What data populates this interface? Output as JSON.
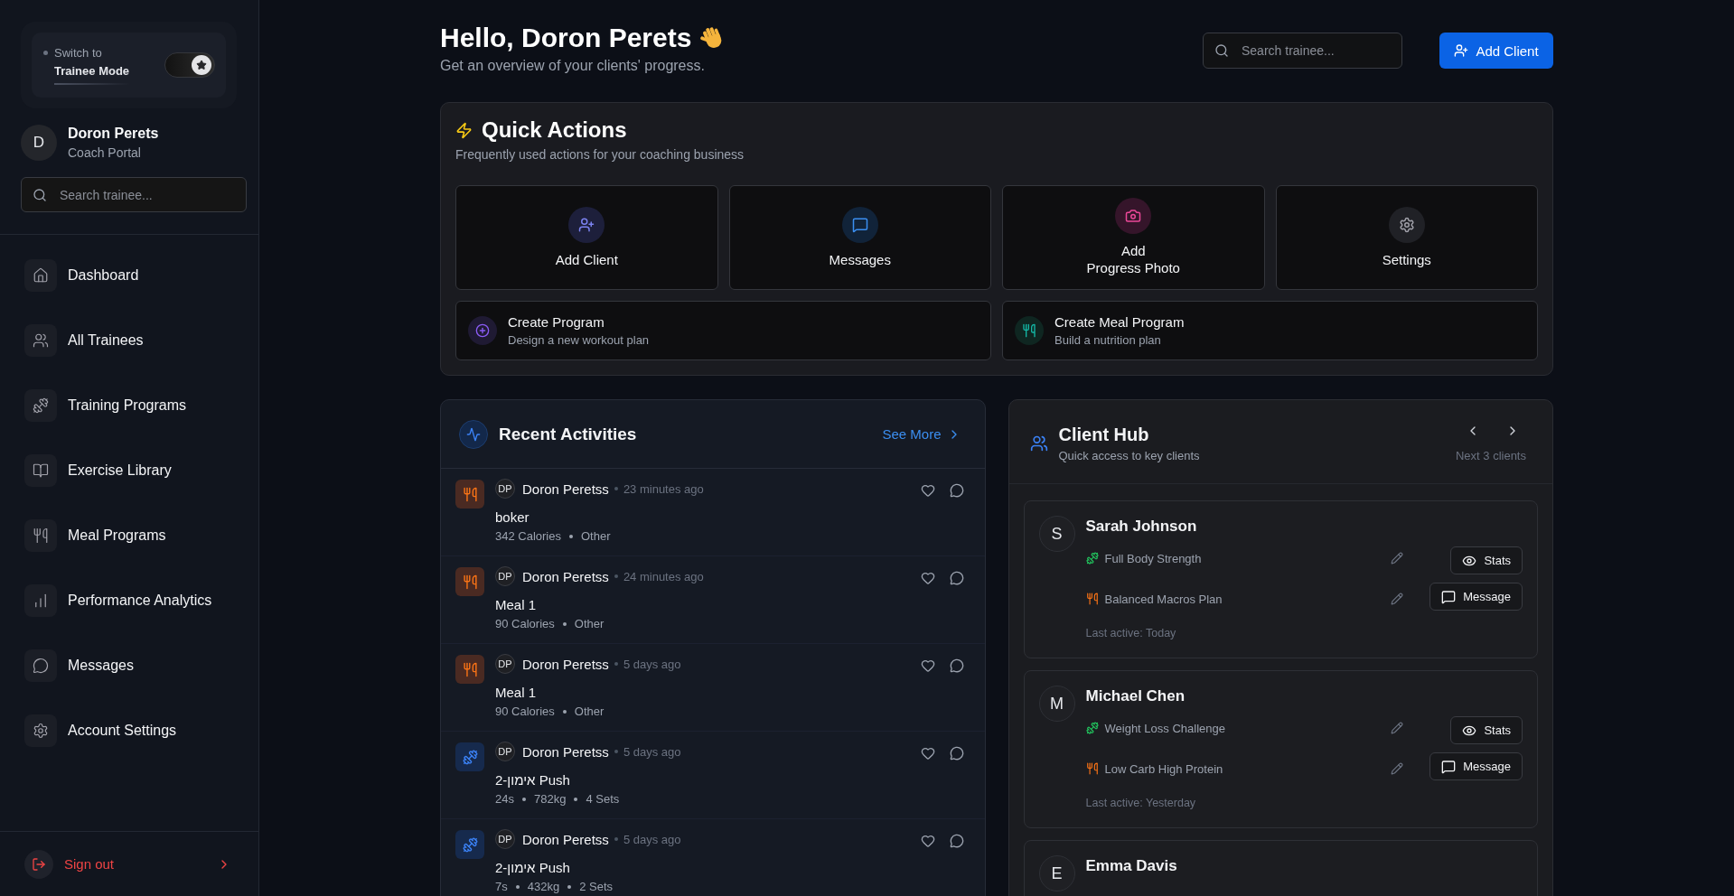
{
  "sidebar": {
    "mode_switch": {
      "prefix": "Switch to",
      "mode": "Trainee Mode",
      "on": true
    },
    "profile": {
      "initial": "D",
      "name": "Doron Perets",
      "role": "Coach Portal"
    },
    "search": {
      "placeholder": "Search trainee..."
    },
    "nav": [
      {
        "label": "Dashboard",
        "kind": "home",
        "selected": false
      },
      {
        "label": "All Trainees",
        "kind": "users",
        "selected": false
      },
      {
        "label": "Training Programs",
        "kind": "workout",
        "selected": false
      },
      {
        "label": "Exercise Library",
        "kind": "book",
        "selected": false
      },
      {
        "label": "Meal Programs",
        "kind": "meal",
        "selected": false
      },
      {
        "label": "Performance Analytics",
        "kind": "chart",
        "selected": false
      },
      {
        "label": "Messages",
        "kind": "message",
        "selected": false
      },
      {
        "label": "Account Settings",
        "kind": "settings",
        "selected": false
      }
    ],
    "sign_out": {
      "label": "Sign out"
    }
  },
  "header": {
    "title": "Hello, Doron Perets",
    "subtitle": "Get an overview of your clients' progress.",
    "search": {
      "placeholder": "Search trainee..."
    },
    "primary_button": "Add Client"
  },
  "quick_actions": {
    "title": "Quick Actions",
    "subtitle": "Frequently used actions for your coaching business",
    "tiles": [
      {
        "label": "Add Client",
        "kind": "client"
      },
      {
        "label": "Messages",
        "kind": "messages"
      },
      {
        "label": "Add\nProgress Photo",
        "kind": "photo"
      },
      {
        "label": "Settings",
        "kind": "settings"
      }
    ],
    "shortcuts": [
      {
        "title": "Create Program",
        "subtitle": "Design a new workout plan",
        "kind": "workout"
      },
      {
        "title": "Create Meal Program",
        "subtitle": "Build a nutrition plan",
        "kind": "meal"
      }
    ]
  },
  "recent_activities": {
    "title": "Recent Activities",
    "link": "See More",
    "items": [
      {
        "kind": "meal",
        "initials": "DP",
        "name": "Doron Peretss",
        "time": "23 minutes ago",
        "title": "boker",
        "meta": [
          "342 Calories",
          "Other"
        ]
      },
      {
        "kind": "meal",
        "initials": "DP",
        "name": "Doron Peretss",
        "time": "24 minutes ago",
        "title": "Meal 1",
        "meta": [
          "90 Calories",
          "Other"
        ]
      },
      {
        "kind": "meal",
        "initials": "DP",
        "name": "Doron Peretss",
        "time": "5 days ago",
        "title": "Meal 1",
        "meta": [
          "90 Calories",
          "Other"
        ]
      },
      {
        "kind": "workout",
        "initials": "DP",
        "name": "Doron Peretss",
        "time": "5 days ago",
        "title": "2-אימון Push",
        "meta": [
          "24s",
          "782kg",
          "4 Sets"
        ]
      },
      {
        "kind": "workout",
        "initials": "DP",
        "name": "Doron Peretss",
        "time": "5 days ago",
        "title": "2-אימון Push",
        "meta": [
          "7s",
          "432kg",
          "2 Sets"
        ]
      }
    ]
  },
  "client_hub": {
    "title": "Client Hub",
    "subtitle": "Quick access to key clients",
    "pager_note": "Next 3 clients",
    "clients": [
      {
        "initial": "S",
        "name": "Sarah Johnson",
        "programs": [
          {
            "kind": "workout",
            "name": "Full Body Strength"
          },
          {
            "kind": "meal",
            "name": "Balanced Macros Plan"
          }
        ],
        "actions": [
          {
            "kind": "stats",
            "label": "Stats"
          },
          {
            "kind": "message",
            "label": "Message"
          }
        ],
        "last_active": "Last active: Today"
      },
      {
        "initial": "M",
        "name": "Michael Chen",
        "programs": [
          {
            "kind": "workout",
            "name": "Weight Loss Challenge"
          },
          {
            "kind": "meal",
            "name": "Low Carb High Protein"
          }
        ],
        "actions": [
          {
            "kind": "stats",
            "label": "Stats"
          },
          {
            "kind": "message",
            "label": "Message"
          }
        ],
        "last_active": "Last active: Yesterday"
      },
      {
        "initial": "E",
        "name": "Emma Davis"
      }
    ]
  }
}
